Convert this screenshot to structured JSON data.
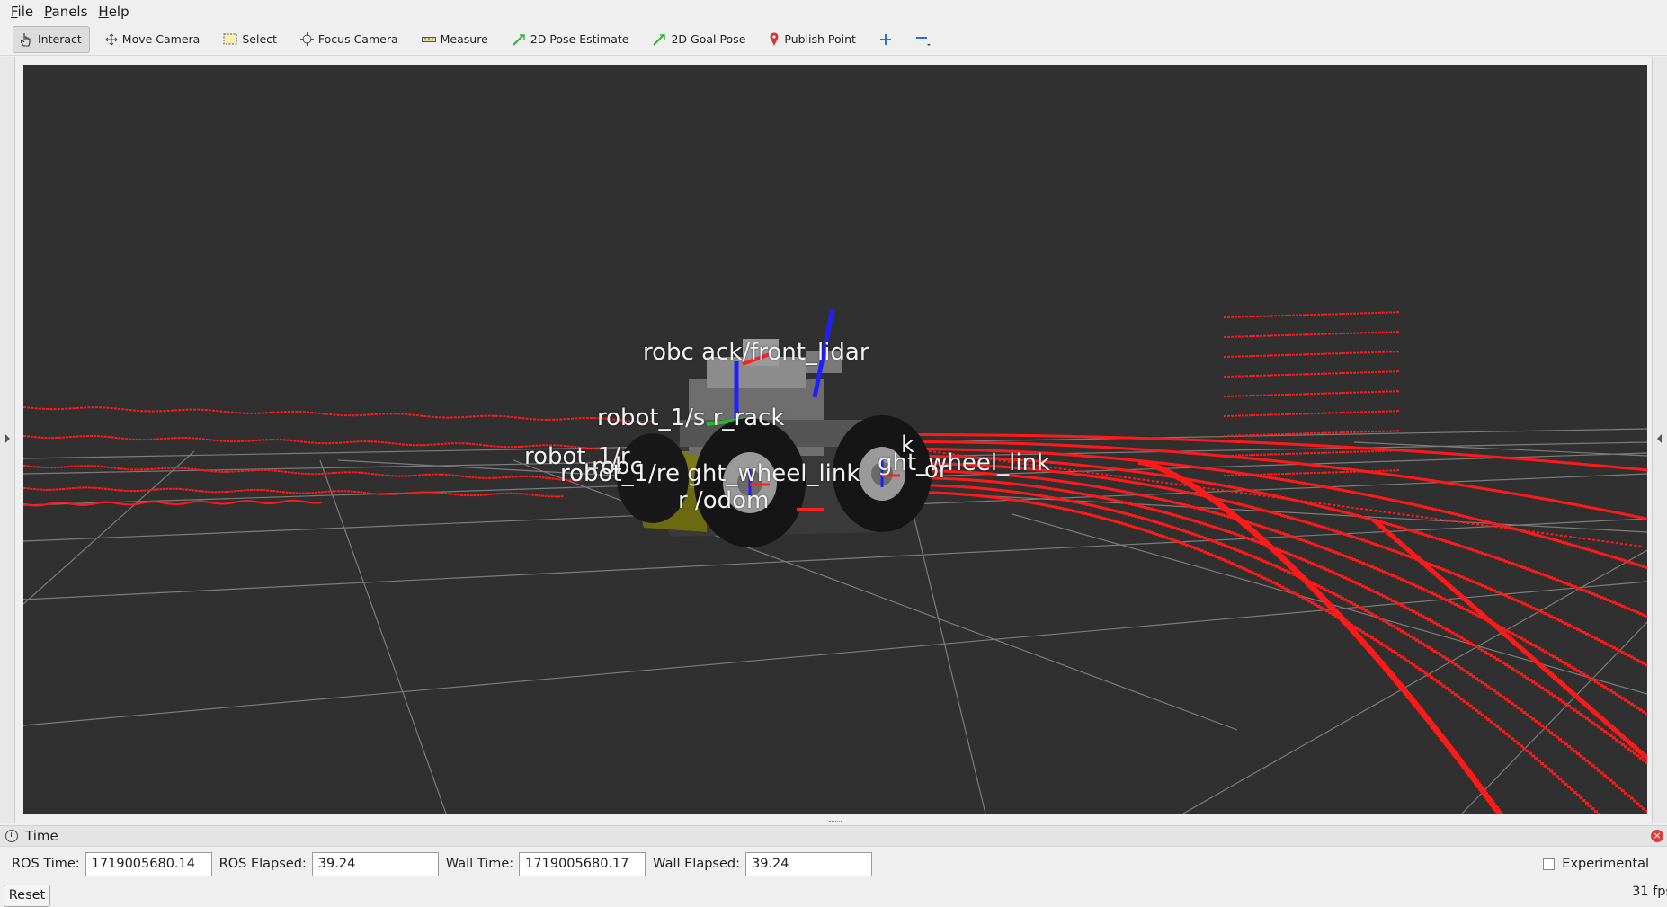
{
  "menu": {
    "items": [
      {
        "label": "File",
        "mnemonic": "F",
        "rest": "ile"
      },
      {
        "label": "Panels",
        "mnemonic": "P",
        "rest": "anels"
      },
      {
        "label": "Help",
        "mnemonic": "H",
        "rest": "elp"
      }
    ]
  },
  "toolbar": {
    "interact": "Interact",
    "move_camera": "Move Camera",
    "select": "Select",
    "focus_camera": "Focus Camera",
    "measure": "Measure",
    "pose_estimate": "2D Pose Estimate",
    "goal_pose": "2D Goal Pose",
    "publish_point": "Publish Point"
  },
  "viewport": {
    "labels": {
      "front_lidar": "robc        ack/front_lidar",
      "sensor_rack": "robot_1/s      r_rack",
      "rear_left": "robot_1/r",
      "rear_left2": "robc",
      "rear_right": "robot_1/re      ght_wheel_link",
      "front_left": "k",
      "front_right": "ght_wheel_link",
      "odom": "r      /odom",
      "base": "or"
    },
    "background": "#303030",
    "laser_color": "#ff1a1a"
  },
  "time_panel": {
    "title": "Time",
    "ros_time_label": "ROS Time:",
    "ros_time": "1719005680.14",
    "ros_elapsed_label": "ROS Elapsed:",
    "ros_elapsed": "39.24",
    "wall_time_label": "Wall Time:",
    "wall_time": "1719005680.17",
    "wall_elapsed_label": "Wall Elapsed:",
    "wall_elapsed": "39.24",
    "experimental": "Experimental"
  },
  "footer": {
    "reset": "Reset",
    "fps": "31 fps"
  }
}
